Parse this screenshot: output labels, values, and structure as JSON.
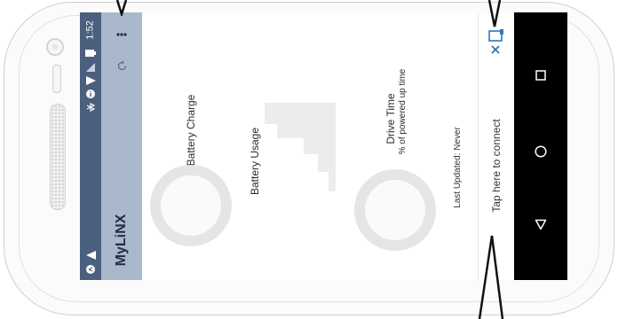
{
  "status_bar": {
    "time": "1:52"
  },
  "app_bar": {
    "title": "MyLiNX"
  },
  "dashboard": {
    "battery_charge_label": "Battery Charge",
    "battery_usage_label": "Battery Usage",
    "drive_time_label": "Drive Time",
    "drive_time_sublabel": "% of powered up time",
    "last_updated": "Last Updated: Never"
  },
  "connection": {
    "connect_prompt": "Tap here to connect"
  },
  "colors": {
    "status_bar": "#4b5f7e",
    "app_bar": "#a9b8cb",
    "title_text": "#1e2d45",
    "accent_blue": "#2f74c5",
    "nav_bar": "#000000"
  },
  "icons": {
    "status_bar": [
      "alert-icon",
      "share-icon",
      "bluetooth-icon",
      "info-icon",
      "wifi-icon",
      "signal-icon",
      "battery-icon"
    ],
    "app_bar": [
      "overflow-menu-icon",
      "refresh-icon"
    ],
    "connection": [
      "bluetooth-device-icon",
      "disconnected-x-icon"
    ],
    "navigation": [
      "recent-apps-icon",
      "home-icon",
      "back-icon"
    ]
  }
}
